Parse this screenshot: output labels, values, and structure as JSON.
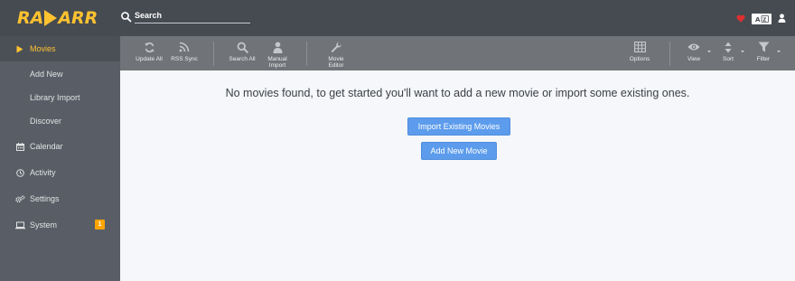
{
  "app": {
    "logo_text_left": "RA",
    "logo_text_right": "ARR",
    "brand_color": "#ffc230"
  },
  "header": {
    "search_placeholder": "Search",
    "icons": [
      "heart-icon",
      "keyboard-shortcuts-icon",
      "user-icon"
    ]
  },
  "sidebar": {
    "items": [
      {
        "label": "Movies",
        "icon": "play-icon",
        "active": true
      },
      {
        "label": "Add New",
        "sub": true
      },
      {
        "label": "Library Import",
        "sub": true
      },
      {
        "label": "Discover",
        "sub": true
      },
      {
        "label": "Calendar",
        "icon": "calendar-icon"
      },
      {
        "label": "Activity",
        "icon": "clock-icon"
      },
      {
        "label": "Settings",
        "icon": "cogs-icon"
      },
      {
        "label": "System",
        "icon": "laptop-icon",
        "badge": "1"
      }
    ]
  },
  "toolbar": {
    "update_all": "Update All",
    "rss_sync": "RSS Sync",
    "search_all": "Search All",
    "manual_import_1": "Manual",
    "manual_import_2": "Import",
    "movie_editor_1": "Movie",
    "movie_editor_2": "Editor",
    "options": "Options",
    "view": "View",
    "sort": "Sort",
    "filter": "Filter"
  },
  "main": {
    "empty_message": "No movies found, to get started you'll want to add a new movie or import some existing ones.",
    "import_button": "Import Existing Movies",
    "add_button": "Add New Movie"
  },
  "colors": {
    "header_bg": "#464b51",
    "sidebar_bg": "#595e66",
    "toolbar_bg": "#707479",
    "primary": "#5d9cec",
    "badge": "#ffa500",
    "heart": "#e02e2e"
  }
}
